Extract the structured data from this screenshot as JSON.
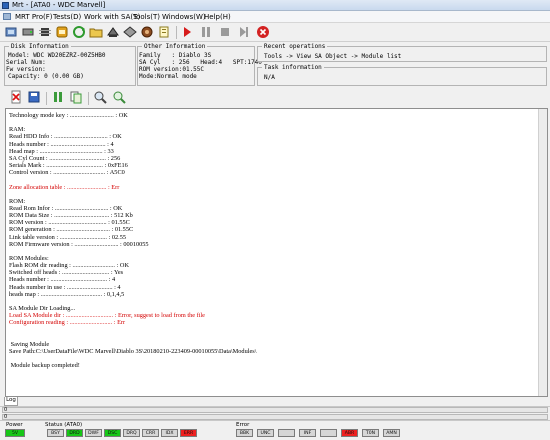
{
  "window": {
    "title": "Mrt - [ATA0 - WDC Marvell]"
  },
  "menu": [
    "MRT Pro(F)",
    "Tests(D)",
    "Work with SA(S)",
    "Tools(T)",
    "Windows(W)",
    "Help(H)"
  ],
  "disk_info": {
    "title": "Disk Information",
    "model": "Model: WDC WD20EZRZ-00Z5HB0",
    "serial": "Serial Num:",
    "firmware": "Fw version:",
    "capacity": "Capacity: 0 (0.00 GB)"
  },
  "other_info": {
    "title": "Other Information",
    "family": "Family   : Diablo 3S",
    "sa_cyl": "SA Cyl   : 256   Head:4   SPT:1740",
    "rom_version": "ROM version:01.55C",
    "mode": "Mode:Normal mode"
  },
  "recent_ops": {
    "title": "Recent operations",
    "value": "Tools -> View SA Object -> Module list"
  },
  "task_info": {
    "title": "Task information",
    "value": "N/A"
  },
  "log_lines": [
    {
      "text": "Technology mode key : ............................ : OK",
      "red": false
    },
    {
      "text": "",
      "red": false
    },
    {
      "text": "RAM:",
      "red": false
    },
    {
      "text": "Read HDD Info : .................................. : OK",
      "red": false
    },
    {
      "text": "Heads number : ................................... : 4",
      "red": false
    },
    {
      "text": "Head map : ........................................ : 33",
      "red": false
    },
    {
      "text": "SA Cyl Count : .................................... : 256",
      "red": false
    },
    {
      "text": "Serials Mark : .................................... : 0xFE16",
      "red": false
    },
    {
      "text": "Control version : ................................. : A5C0",
      "red": false
    },
    {
      "text": "",
      "red": false
    },
    {
      "text": "Zone allocation table : ......................... : Err",
      "red": true
    },
    {
      "text": "",
      "red": false
    },
    {
      "text": "ROM:",
      "red": false
    },
    {
      "text": "Read Rom Infor : .................................. : OK",
      "red": false
    },
    {
      "text": "ROM Data Size : ................................... : 512 Kb",
      "red": false
    },
    {
      "text": "ROM version : ..................................... : 01.55C",
      "red": false
    },
    {
      "text": "ROM generation : .................................. : 01.55C",
      "red": false
    },
    {
      "text": "Link table version : .............................. : 02.55",
      "red": false
    },
    {
      "text": "ROM Firmware version : ............................ : 00010055",
      "red": false
    },
    {
      "text": "",
      "red": false
    },
    {
      "text": "ROM Modules:",
      "red": false
    },
    {
      "text": "Flash ROM dir reading : ........................... : OK",
      "red": false
    },
    {
      "text": "Switched off heads : .............................. : Yes",
      "red": false
    },
    {
      "text": "Heads number : .................................... : 4",
      "red": false
    },
    {
      "text": "Heads number in use : ............................. : 4",
      "red": false
    },
    {
      "text": "heads map : ....................................... : 0,1,4,5",
      "red": false
    },
    {
      "text": "",
      "red": false
    },
    {
      "text": "SA Module Dir Loading...",
      "red": false
    },
    {
      "text": "Load SA Module dir : .............................. : Error, suggest to load from the file",
      "red": true
    },
    {
      "text": "Configuration reading : ........................... : Err",
      "red": true
    },
    {
      "text": "",
      "red": false
    },
    {
      "text": "",
      "red": false
    },
    {
      "text": " Saving Module",
      "red": false
    },
    {
      "text": "Save Path:C:\\UserDataFile\\WDC Marvell\\Diablo 3S\\20180210-223409-00010055\\Data\\Modules\\",
      "red": false
    },
    {
      "text": "",
      "red": false
    },
    {
      "text": " Module backup completed!",
      "red": false
    }
  ],
  "tab_label": "Log",
  "progress": {
    "label1": "0",
    "label2": "0"
  },
  "status": {
    "power_title": "Power",
    "power": [
      {
        "label": "5V",
        "state": "green"
      }
    ],
    "status_title": "Status (ATA0)",
    "status": [
      {
        "label": "BSY",
        "state": "off"
      },
      {
        "label": "DRD",
        "state": "green"
      },
      {
        "label": "DWF",
        "state": "off"
      },
      {
        "label": "DSC",
        "state": "green"
      },
      {
        "label": "DRQ",
        "state": "off"
      },
      {
        "label": "CRR",
        "state": "off"
      },
      {
        "label": "IDX",
        "state": "off"
      },
      {
        "label": "ERR",
        "state": "red"
      }
    ],
    "error_title": "Error",
    "error": [
      {
        "label": "BBK",
        "state": "off"
      },
      {
        "label": "UNC",
        "state": "off"
      },
      {
        "label": "",
        "state": "off"
      },
      {
        "label": "INF",
        "state": "off"
      },
      {
        "label": "",
        "state": "off"
      },
      {
        "label": "ABR",
        "state": "red"
      },
      {
        "label": "T0N",
        "state": "off"
      },
      {
        "label": "AMN",
        "state": "off"
      }
    ]
  },
  "colors": {
    "accent_red": "#d40000",
    "indicator_green": "#17c617",
    "indicator_red": "#ee2020"
  }
}
